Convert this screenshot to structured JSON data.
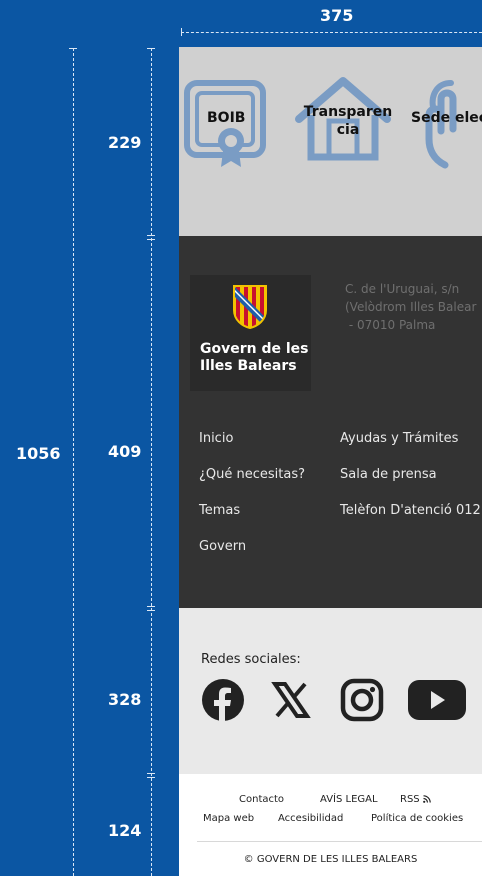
{
  "measurements": {
    "top_width": "375",
    "total_height": "1056",
    "section_heights": [
      "229",
      "409",
      "328",
      "124"
    ]
  },
  "quick_links": [
    {
      "label": "BOIB",
      "icon": "certificate-icon"
    },
    {
      "label": "Transparen\ncia",
      "icon": "house-icon"
    },
    {
      "label": "Sede elec",
      "icon": "touch-hand-icon"
    }
  ],
  "footer": {
    "logo_text": "Govern de les\nIlles Balears",
    "address": [
      "C. de l'Uruguai, s/n",
      "(Velòdrom Illes Balear",
      " - 07010 Palma"
    ],
    "nav_left": [
      "Inicio",
      "¿Qué necesitas?",
      "Temas",
      "Govern"
    ],
    "nav_right": [
      "Ayudas y Trámites",
      "Sala de prensa",
      "Telèfon D'atenció 012"
    ]
  },
  "social": {
    "title": "Redes sociales:",
    "icons": [
      "facebook-icon",
      "x-twitter-icon",
      "instagram-icon",
      "youtube-icon"
    ]
  },
  "legal": {
    "row1": [
      "Contacto",
      "AVÍS LEGAL",
      "RSS"
    ],
    "row2": [
      "Mapa web",
      "Accesibilidad",
      "Política de cookies"
    ],
    "copyright": "© GOVERN DE LES ILLES BALEARS"
  },
  "colors": {
    "background": "#0b56a3",
    "icon_blue": "#7a9cc4",
    "footer_dark": "#333333",
    "logo_red": "#c8102e",
    "logo_yellow": "#f2c300"
  }
}
